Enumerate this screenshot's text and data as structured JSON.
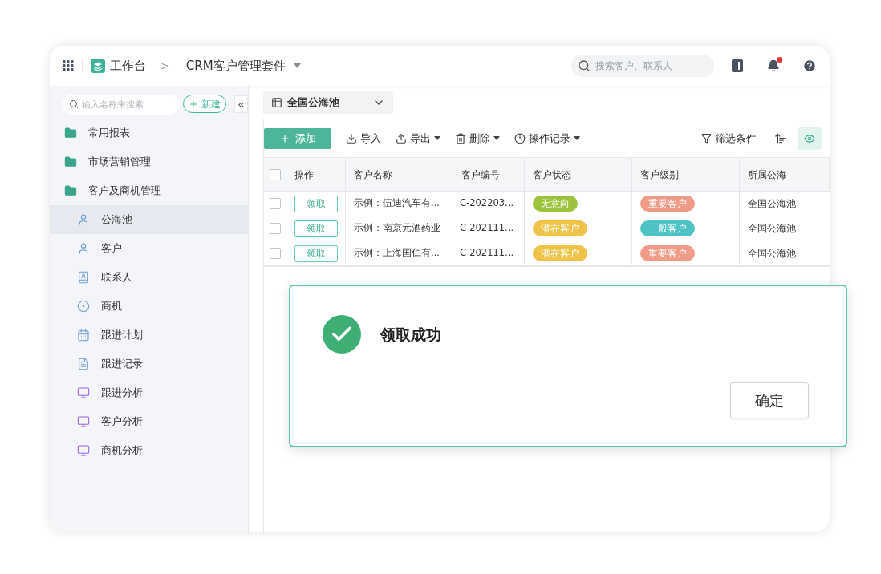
{
  "header": {
    "workspace": "工作台",
    "breadcrumb_separator": ">",
    "app_title": "CRM客户管理套件",
    "search": {
      "placeholder": "搜索客户、联系人"
    },
    "notification_dot": true
  },
  "sidebar": {
    "search": {
      "placeholder": "输入名称来搜索"
    },
    "new_button": "新建",
    "collapse": "«",
    "items": [
      {
        "label": "常用报表",
        "kind": "folder",
        "selected": false
      },
      {
        "label": "市场营销管理",
        "kind": "folder",
        "selected": false
      },
      {
        "label": "客户及商机管理",
        "kind": "folder",
        "selected": false,
        "children": [
          {
            "label": "公海池",
            "kind": "pool",
            "selected": true
          },
          {
            "label": "客户",
            "kind": "person",
            "selected": false
          },
          {
            "label": "联系人",
            "kind": "contacts",
            "selected": false
          },
          {
            "label": "商机",
            "kind": "deal",
            "selected": false
          },
          {
            "label": "跟进计划",
            "kind": "plan",
            "selected": false
          },
          {
            "label": "跟进记录",
            "kind": "record",
            "selected": false
          },
          {
            "label": "跟进分析",
            "kind": "analysis",
            "selected": false
          },
          {
            "label": "客户分析",
            "kind": "analysis",
            "selected": false
          },
          {
            "label": "商机分析",
            "kind": "analysis",
            "selected": false
          }
        ]
      }
    ]
  },
  "view_selector": {
    "label": "全国公海池"
  },
  "toolbar": {
    "add": "添加",
    "actions": [
      {
        "label": "导入",
        "kind": "import",
        "caret": false
      },
      {
        "label": "导出",
        "kind": "export",
        "caret": true
      },
      {
        "label": "删除",
        "kind": "delete",
        "caret": true
      },
      {
        "label": "操作记录",
        "kind": "history",
        "caret": true
      }
    ],
    "filter": "筛选条件",
    "view_toggle_active": true
  },
  "table": {
    "all_checked": false,
    "columns": [
      "操作",
      "客户名称",
      "客户编号",
      "客户状态",
      "客户级别",
      "所属公海"
    ],
    "rows": [
      {
        "checked": false,
        "action": "领取",
        "name": "示例：伍迪汽车有...",
        "code": "C-202203...",
        "status": {
          "label": "无意向",
          "color": "#9cc33b"
        },
        "level": {
          "label": "重要客户",
          "color": "#f09a88"
        },
        "pool": "全国公海池"
      },
      {
        "checked": false,
        "action": "领取",
        "name": "示例：南京元酒药业",
        "code": "C-202111...",
        "status": {
          "label": "潜在客户",
          "color": "#efc24a"
        },
        "level": {
          "label": "一般客户",
          "color": "#4dc2c4"
        },
        "pool": "全国公海池"
      },
      {
        "checked": false,
        "action": "领取",
        "name": "示例：上海国仁有...",
        "code": "C-202111...",
        "status": {
          "label": "潜在客户",
          "color": "#efc24a"
        },
        "level": {
          "label": "重要客户",
          "color": "#f09a88"
        },
        "pool": "全国公海池"
      }
    ]
  },
  "dialog": {
    "message": "领取成功",
    "confirm": "确定"
  }
}
